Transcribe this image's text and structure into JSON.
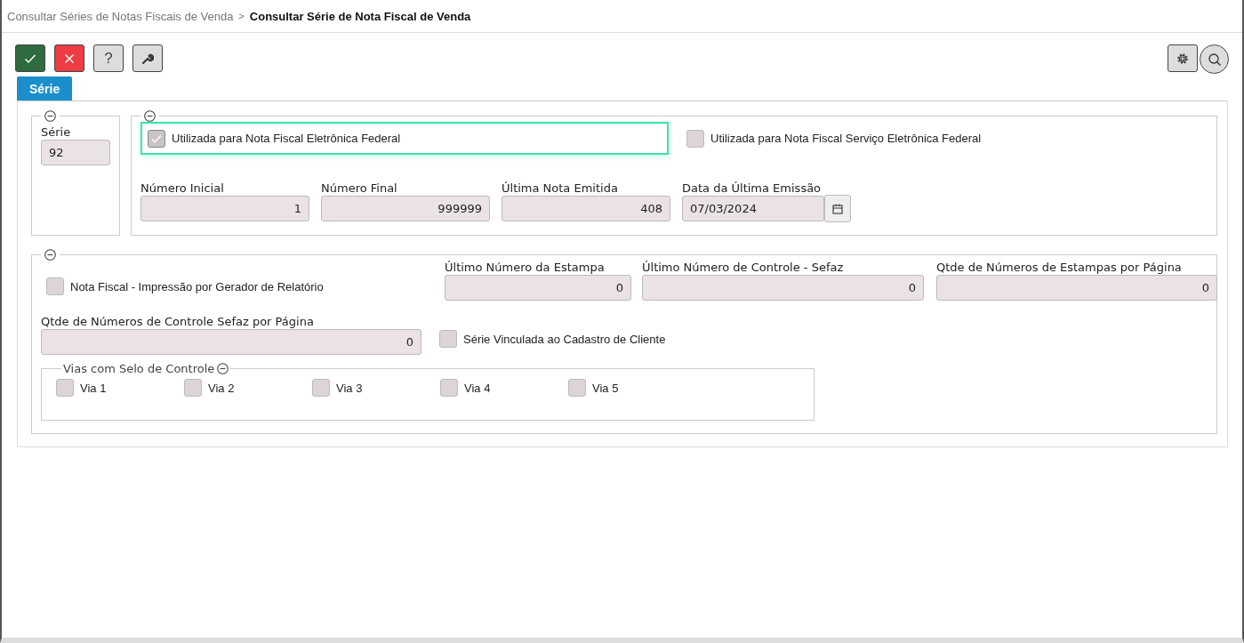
{
  "breadcrumb": {
    "parent": "Consultar Séries de Notas Fiscais de Venda",
    "separator": ">",
    "current": "Consultar Série de Nota Fiscal de Venda"
  },
  "toolbar": [
    {
      "kind": "confirm"
    },
    {
      "kind": "cancel"
    },
    {
      "kind": "help",
      "glyph": "?"
    },
    {
      "kind": "tools"
    }
  ],
  "toolbar_right": [
    {
      "kind": "settings"
    },
    {
      "kind": "search"
    }
  ],
  "tabs": [
    {
      "label": "Série",
      "selected": true
    }
  ],
  "serie": {
    "label": "Série",
    "value": "92"
  },
  "nfe_federal": {
    "label": "Utilizada para Nota Fiscal Eletrônica Federal",
    "checked": true,
    "focused": true
  },
  "nfse_federal": {
    "label": "Utilizada para Nota Fiscal Serviço Eletrônica Federal",
    "checked": false
  },
  "numbers": [
    {
      "label": "Número Inicial",
      "value": "1",
      "kind": "number"
    },
    {
      "label": "Número Final",
      "value": "999999",
      "kind": "number"
    },
    {
      "label": "Última Nota Emitida",
      "value": "408",
      "kind": "number"
    },
    {
      "label": "Data da Última Emissão",
      "value": "07/03/2024",
      "kind": "date"
    }
  ],
  "impressao_gerador": {
    "label": "Nota Fiscal - Impressão por Gerador de Relatório",
    "checked": false
  },
  "estampas": [
    {
      "label": "Último Número da Estampa",
      "value": "0"
    },
    {
      "label": "Último Número de Controle - Sefaz",
      "value": "0"
    },
    {
      "label": "Qtde de Números de Estampas por Página",
      "value": "0"
    }
  ],
  "controle_por_pagina": {
    "label": "Qtde de Números de Controle Sefaz por Página",
    "value": "0"
  },
  "vinculada_cliente": {
    "label": "Série Vinculada ao Cadastro de Cliente",
    "checked": false
  },
  "vias": {
    "title": "Vias com Selo de Controle",
    "items": [
      {
        "label": "Via 1",
        "checked": false
      },
      {
        "label": "Via 2",
        "checked": false
      },
      {
        "label": "Via 3",
        "checked": false
      },
      {
        "label": "Via 4",
        "checked": false
      },
      {
        "label": "Via 5",
        "checked": false
      }
    ]
  }
}
